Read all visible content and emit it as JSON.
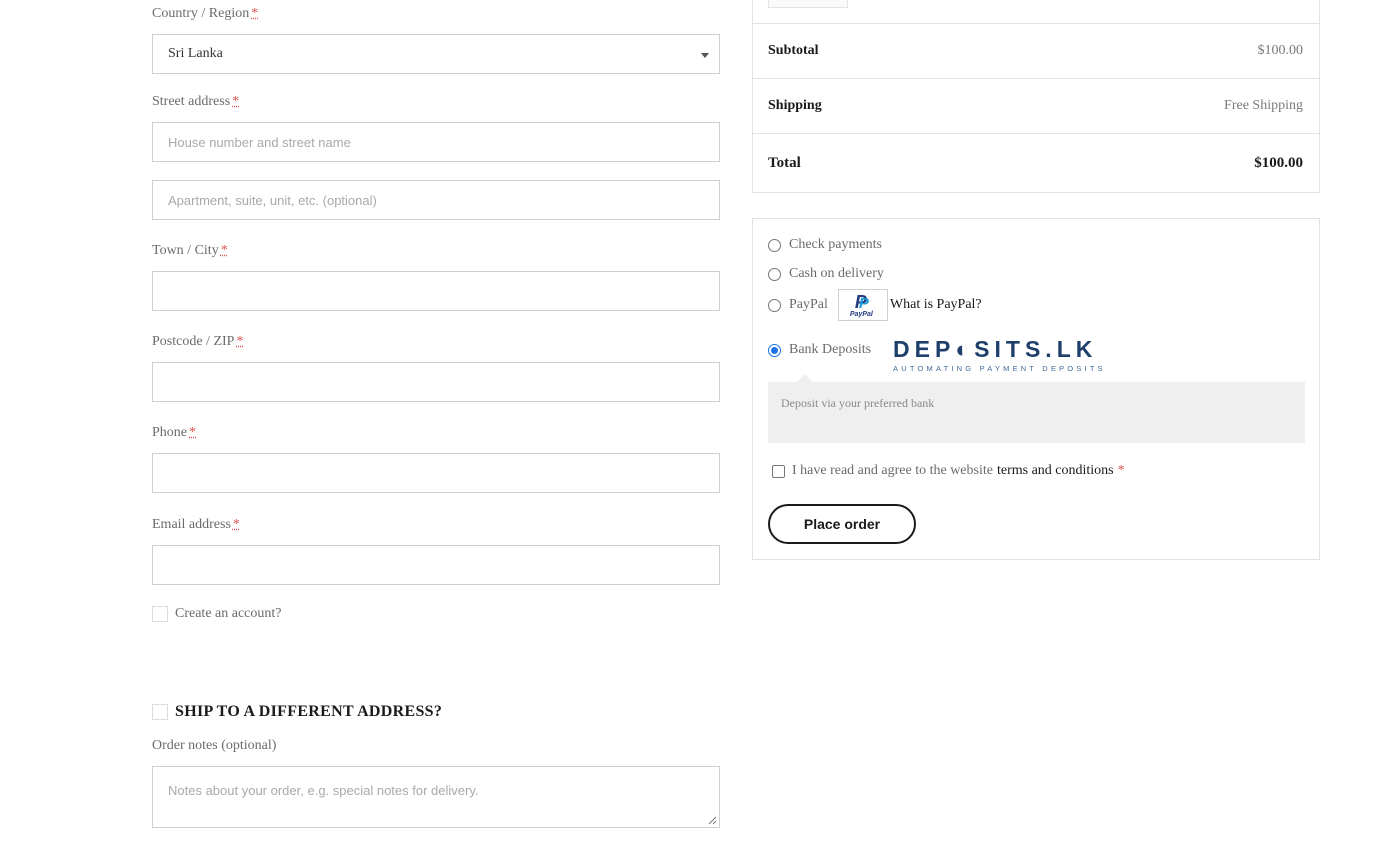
{
  "billing": {
    "country": {
      "label": "Country / Region",
      "required": "*",
      "value": "Sri Lanka"
    },
    "street": {
      "label": "Street address",
      "required": "*",
      "placeholder1": "House number and street name",
      "placeholder2": "Apartment, suite, unit, etc. (optional)"
    },
    "city": {
      "label": "Town / City",
      "required": "*"
    },
    "postcode": {
      "label": "Postcode / ZIP",
      "required": "*"
    },
    "phone": {
      "label": "Phone",
      "required": "*"
    },
    "email": {
      "label": "Email address",
      "required": "*"
    },
    "create_account": "Create an account?"
  },
  "shipping": {
    "heading": "SHIP TO A DIFFERENT ADDRESS?",
    "notes_label": "Order notes (optional)",
    "notes_placeholder": "Notes about your order, e.g. special notes for delivery."
  },
  "totals": {
    "subtotal_label": "Subtotal",
    "subtotal_value": "$100.00",
    "shipping_label": "Shipping",
    "shipping_value": "Free Shipping",
    "total_label": "Total",
    "total_value": "$100.00"
  },
  "payment": {
    "methods": [
      {
        "label": "Check payments",
        "selected": false
      },
      {
        "label": "Cash on delivery",
        "selected": false
      },
      {
        "label": "PayPal",
        "selected": false
      },
      {
        "label": "Bank Deposits",
        "selected": true
      }
    ],
    "paypal_logo_text": "PayPal",
    "paypal_link": "What is PayPal?",
    "deposits_logo": {
      "brand": "DEP◐SITS.LK",
      "tagline": "AUTOMATING PAYMENT DEPOSITS"
    },
    "description": "Deposit via your preferred bank",
    "terms_prefix": "I have read and agree to the website",
    "terms_link": "terms and conditions",
    "terms_required": "*",
    "place_order": "Place order"
  },
  "colors": {
    "accent": "#1a73e8",
    "required": "#d9534f",
    "brand_blue": "#1f3f6b"
  }
}
